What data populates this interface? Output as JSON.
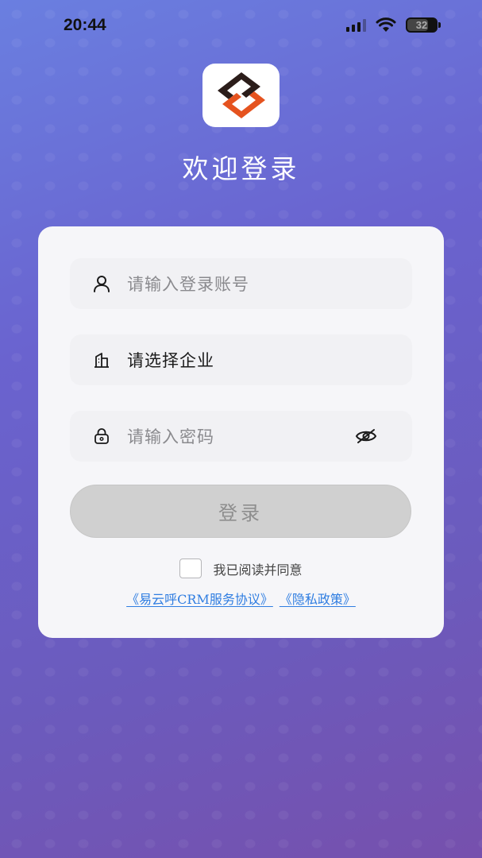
{
  "status_bar": {
    "time": "20:44",
    "battery_level": "32",
    "icons": [
      "cellular-signal-icon",
      "wifi-icon",
      "battery-icon"
    ]
  },
  "brand": {
    "logo_icon": "company-logo",
    "colors": {
      "logo_dark": "#2b1d1a",
      "logo_orange": "#e5531f"
    }
  },
  "welcome_title": "欢迎登录",
  "form": {
    "account": {
      "placeholder": "请输入登录账号",
      "icon": "user-icon"
    },
    "enterprise": {
      "value": "请选择企业",
      "icon": "building-icon"
    },
    "password": {
      "placeholder": "请输入密码",
      "icon": "lock-icon",
      "toggle_icon": "eye-off-icon"
    },
    "login_label": "登录",
    "agreement": {
      "checked": false,
      "text": "我已阅读并同意",
      "service_link": "《易云呼CRM服务协议》",
      "privacy_link": "《隐私政策》"
    }
  },
  "colors": {
    "link": "#2f7de1",
    "button_disabled": "#d0d0d0",
    "background_top": "#6a7fe0",
    "background_bottom": "#7650ad"
  }
}
